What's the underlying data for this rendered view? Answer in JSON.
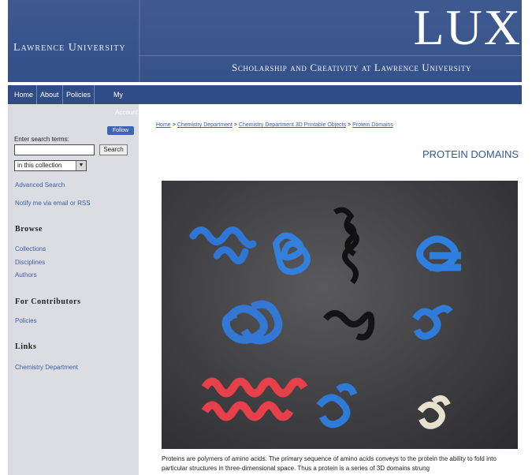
{
  "header": {
    "university": "Lawrence University",
    "brand": "LUX",
    "tagline": "Scholarship and Creativity at Lawrence University"
  },
  "nav": {
    "items": [
      "Home",
      "About",
      "Policies",
      "My"
    ]
  },
  "sidebar": {
    "account_label": "Account",
    "follow_label": "Follow",
    "search_label": "Enter search terms:",
    "search_input_value": "",
    "search_button": "Search",
    "scope_select": "in this collection",
    "advanced_search": "Advanced Search",
    "notify": "Notify me via email or RSS",
    "browse_heading": "Browse",
    "browse_items": [
      "Collections",
      "Disciplines",
      "Authors"
    ],
    "contributors_heading": "For Contributors",
    "contributors_items": [
      "Policies"
    ],
    "links_heading": "Links",
    "links_items": [
      "Chemistry Department"
    ]
  },
  "breadcrumb": {
    "items": [
      "Home",
      "Chemistry Department",
      "Chemistry Department 3D Printable Objects",
      "Protein Domains"
    ],
    "separator": ">"
  },
  "page_title": "PROTEIN DOMAINS",
  "photo_alt": "3D printed protein domain models",
  "paragraph": "Proteins are polymers of amino acids. The primary sequence of amino acids conveys to the protein the ability to fold into particular structures in three-dimensional space. Thus a protein is a series of 3D domains strung"
}
